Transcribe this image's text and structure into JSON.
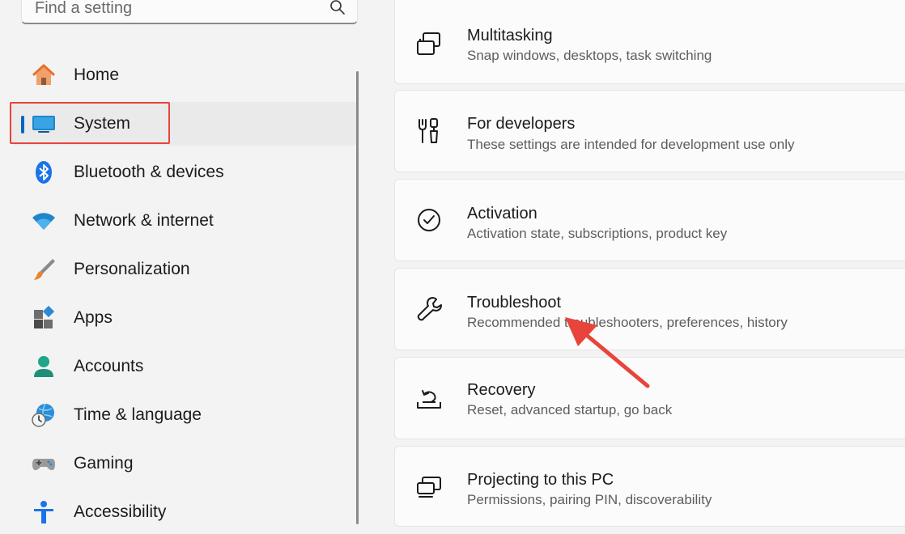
{
  "search": {
    "placeholder": "Find a setting",
    "icon": "search-icon"
  },
  "sidebar": {
    "items": [
      {
        "label": "Home",
        "icon": "home-icon"
      },
      {
        "label": "System",
        "icon": "system-icon",
        "selected": true
      },
      {
        "label": "Bluetooth & devices",
        "icon": "bluetooth-icon"
      },
      {
        "label": "Network & internet",
        "icon": "wifi-icon"
      },
      {
        "label": "Personalization",
        "icon": "brush-icon"
      },
      {
        "label": "Apps",
        "icon": "apps-icon"
      },
      {
        "label": "Accounts",
        "icon": "accounts-icon"
      },
      {
        "label": "Time & language",
        "icon": "globe-clock-icon"
      },
      {
        "label": "Gaming",
        "icon": "gamepad-icon"
      },
      {
        "label": "Accessibility",
        "icon": "accessibility-icon"
      }
    ]
  },
  "main": {
    "cards": [
      {
        "title": "Multitasking",
        "desc": "Snap windows, desktops, task switching",
        "icon": "multitasking-icon"
      },
      {
        "title": "For developers",
        "desc": "These settings are intended for development use only",
        "icon": "developer-tools-icon"
      },
      {
        "title": "Activation",
        "desc": "Activation state, subscriptions, product key",
        "icon": "checkmark-circle-icon"
      },
      {
        "title": "Troubleshoot",
        "desc": "Recommended troubleshooters, preferences, history",
        "icon": "wrench-icon"
      },
      {
        "title": "Recovery",
        "desc": "Reset, advanced startup, go back",
        "icon": "recovery-icon"
      },
      {
        "title": "Projecting to this PC",
        "desc": "Permissions, pairing PIN, discoverability",
        "icon": "projecting-icon"
      }
    ]
  },
  "colors": {
    "accent": "#0067c0",
    "annotation_red": "#e8443b"
  }
}
